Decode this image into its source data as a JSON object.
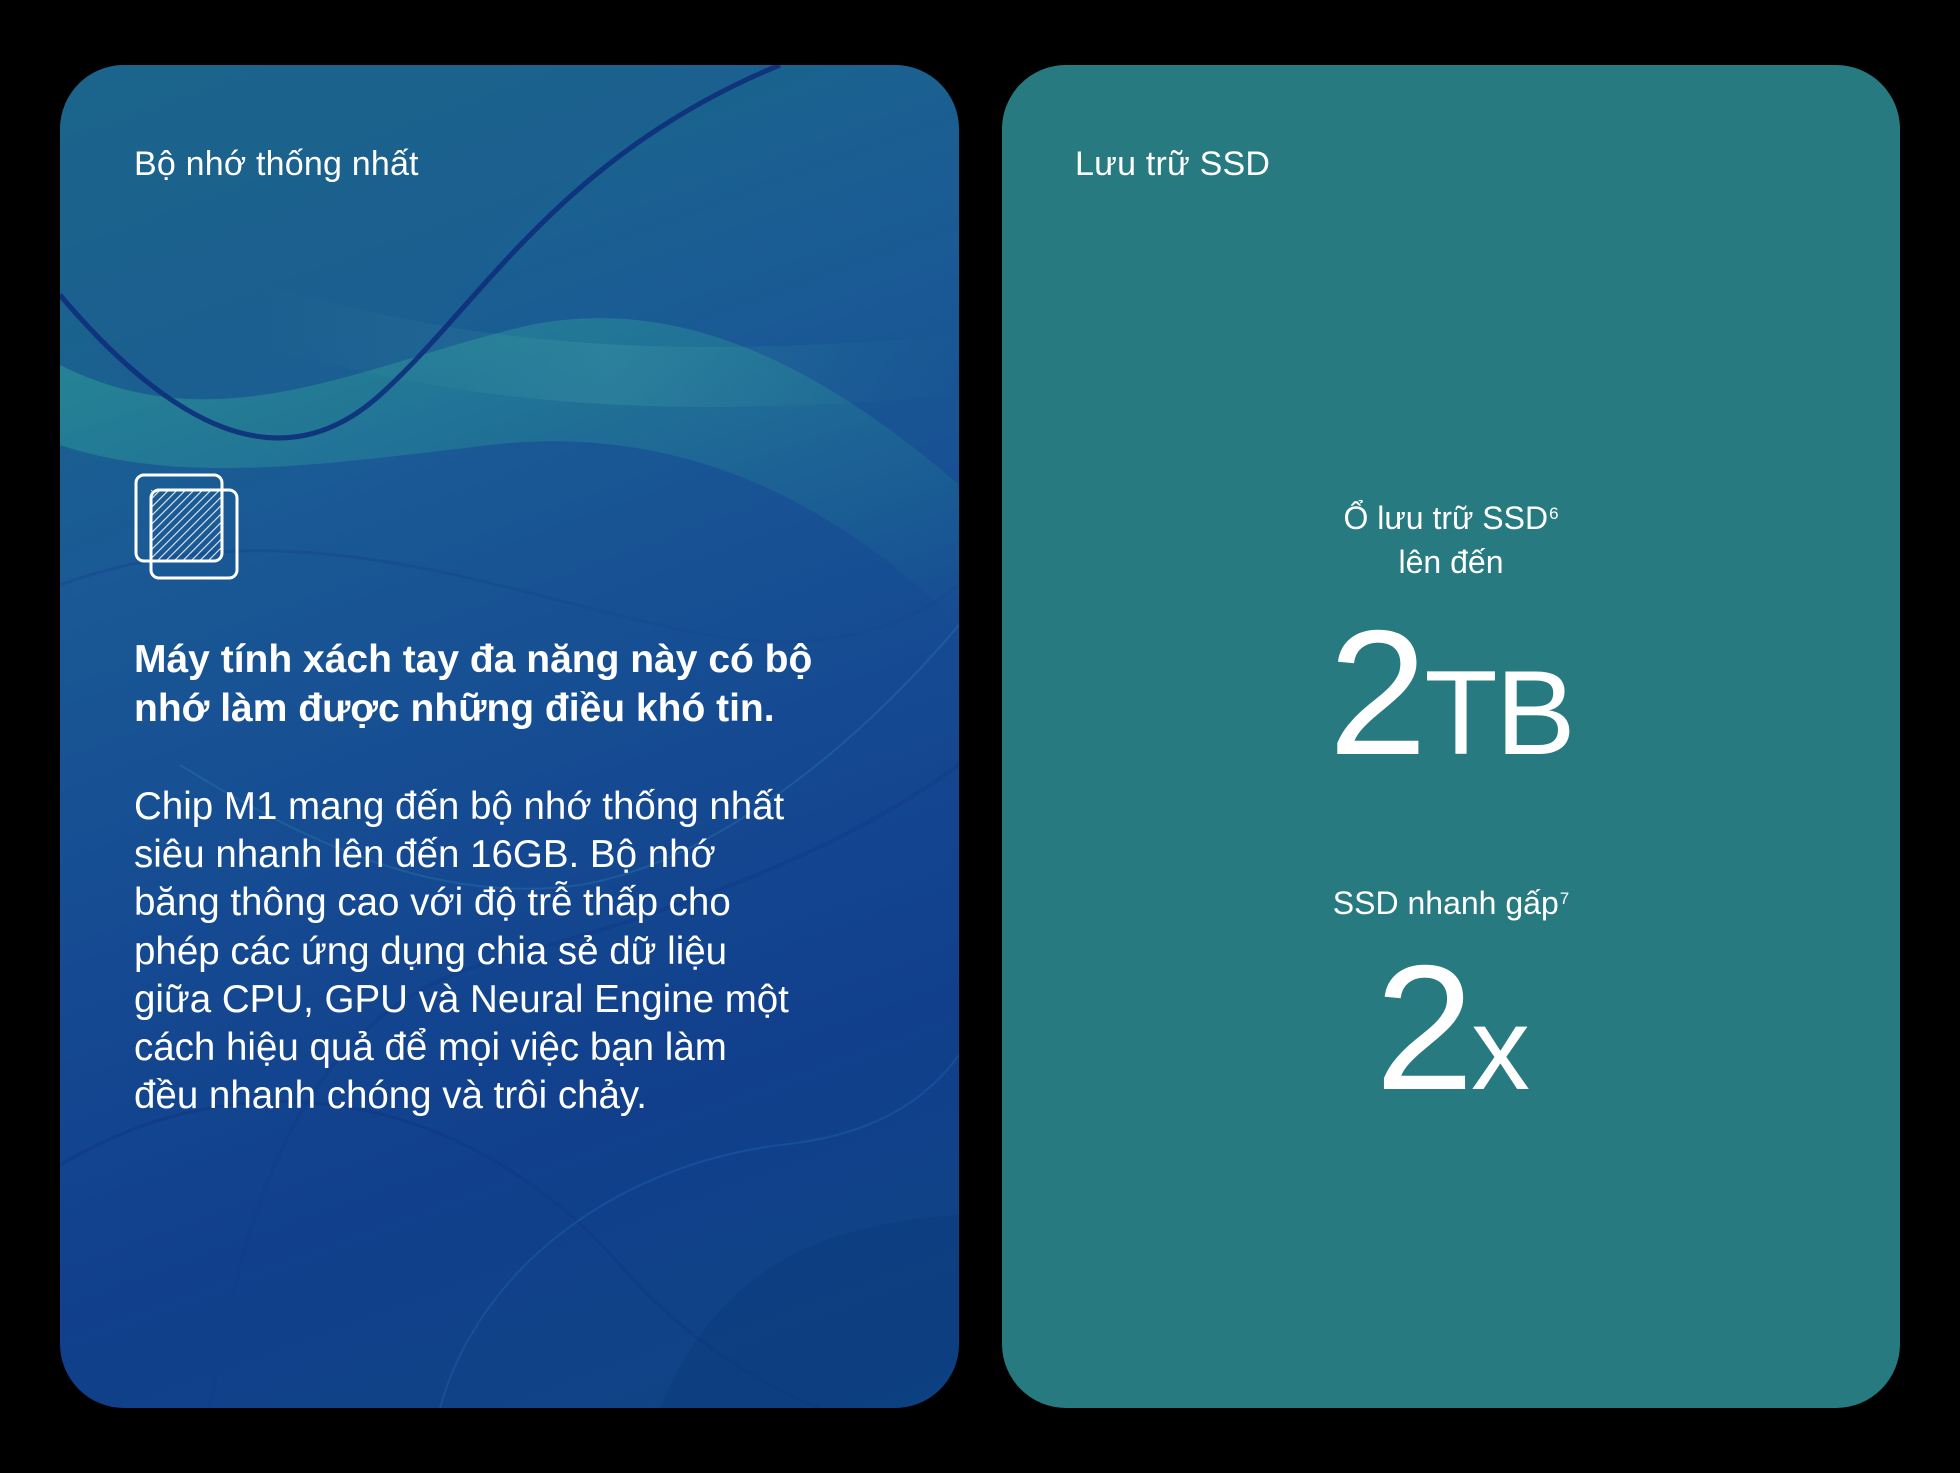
{
  "memory_card": {
    "eyebrow": "Bộ nhớ thống nhất",
    "icon": "unified-memory-chip-icon",
    "headline_line1": "Máy tính xách tay đa năng này có bộ",
    "headline_line2": "nhớ làm được những điều khó tin.",
    "body_lines": [
      "Chip M1 mang đến bộ nhớ thống nhất",
      "siêu nhanh lên đến 16GB. Bộ nhớ",
      "băng thông cao với độ trễ thấp cho",
      "phép các ứng dụng chia sẻ dữ liệu",
      "giữa CPU, GPU và Neural Engine một",
      "cách hiệu quả để mọi việc bạn làm",
      "đều nhanh chóng và trôi chảy."
    ]
  },
  "ssd_card": {
    "eyebrow": "Lưu trữ SSD",
    "stat_capacity": {
      "label_line1": "Ổ lưu trữ SSD",
      "label_footnote": "6",
      "label_line2": "lên đến",
      "value": "2",
      "unit": "TB"
    },
    "stat_speed": {
      "label": "SSD nhanh gấp",
      "label_footnote": "7",
      "value": "2",
      "unit": "x"
    }
  },
  "colors": {
    "page_background": "#000000",
    "memory_card_gradient_start": "#1a6c86",
    "memory_card_gradient_end": "#113f8c",
    "ssd_card_background": "#277a80",
    "text": "#ffffff"
  }
}
